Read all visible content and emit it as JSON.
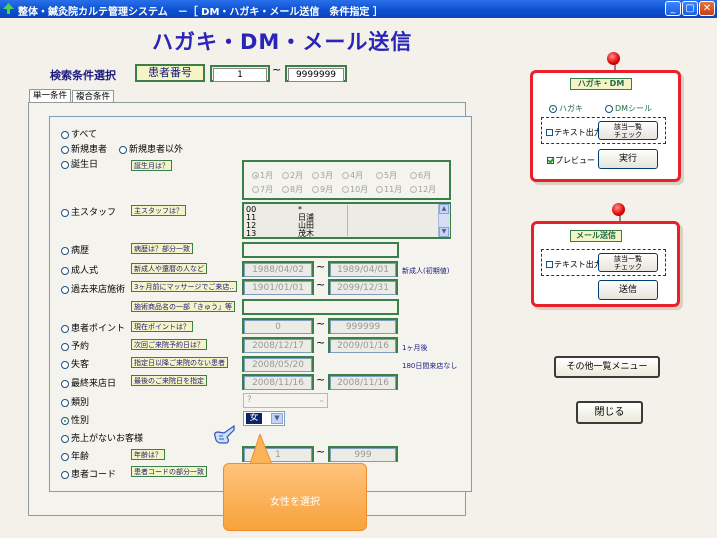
{
  "window": {
    "title": "整体・鍼灸院カルテ管理システム　－［ DM・ハガキ・メール送信　条件指定 ］",
    "colors": {
      "titlebar": "#0b4fd0",
      "accent_green": "#3a7f49",
      "headline": "#2a24b8",
      "card_border": "#e8202a"
    }
  },
  "header": {
    "headline": "ハガキ・DM・メール送信",
    "search_label": "検索条件選択",
    "patient_label": "患者番号",
    "range_from": "1",
    "range_sep": "~",
    "range_to": "9999999"
  },
  "tabs": [
    {
      "label": "単一条件",
      "active": true
    },
    {
      "label": "複合条件",
      "active": false
    }
  ],
  "conditions": {
    "all": "すべて",
    "new_patient": "新規患者",
    "not_new_patient": "新規患者以外",
    "birthday": "誕生日",
    "birthday_tag": "誕生月は？",
    "months_row1": [
      "1月",
      "2月",
      "3月",
      "4月",
      "5月",
      "6月"
    ],
    "months_row2": [
      "7月",
      "8月",
      "9月",
      "10月",
      "11月",
      "12月"
    ],
    "main_staff": "主スタッフ",
    "main_staff_tag": "主スタッフは？",
    "staff_list": [
      {
        "code": "00",
        "name": "*"
      },
      {
        "code": "11",
        "name": "日浦"
      },
      {
        "code": "12",
        "name": "山田"
      },
      {
        "code": "13",
        "name": "茂木"
      }
    ],
    "history": "病歴",
    "history_tag": "病歴は？部分一致",
    "coming_of_age": "成人式",
    "coming_of_age_tag": "新成人や還暦の人など",
    "coming_from": "1988/04/02",
    "coming_to": "1989/04/01",
    "coming_note": "新成人(初期値)",
    "past_treatment": "過去来店施術",
    "past_treatment_tag": "3ヶ月前にマッサージでご来店‥",
    "past_from": "1901/01/01",
    "past_to": "2099/12/31",
    "product_tag": "施術商品名の一部「きゅう」等",
    "points": "患者ポイント",
    "points_tag": "現在ポイントは？",
    "points_from": "0",
    "points_to": "999999",
    "reservation": "予約",
    "reservation_tag": "次回ご来院予約日は？",
    "res_from": "2008/12/17",
    "res_to": "2009/01/16",
    "res_note": "1ヶ月後",
    "lost": "失客",
    "lost_tag": "指定日以降ご来院のない患者",
    "lost_date": "2008/05/20",
    "lost_note": "180日間来店なし",
    "last_visit": "最終来店日",
    "last_visit_tag": "最後のご来院日を指定",
    "last_from": "2008/11/16",
    "last_to": "2008/11/16",
    "category": "類別",
    "category_value": "?",
    "gender": "性別",
    "gender_value": "女",
    "no_sales": "売上がないお客様",
    "age": "年齢",
    "age_tag": "年齢は？",
    "age_from": "1",
    "age_to": "999",
    "patient_code": "患者コード",
    "patient_code_tag": "患者コードの部分一致",
    "selected": "性別"
  },
  "callout": {
    "text": "女性を選択"
  },
  "dm_card": {
    "title": "ハガキ・DM",
    "opt_postcard": "ハガキ",
    "opt_seal": "DMシール",
    "selected": "ハガキ",
    "text_output": "テキスト出力",
    "applicable_list": "該当一覧\nチェック",
    "applicable_line1": "該当一覧",
    "applicable_line2": "チェック",
    "preview": "プレビュー",
    "preview_checked": true,
    "run": "実行"
  },
  "mail_card": {
    "title": "メール送信",
    "text_output": "テキスト出力",
    "applicable_line1": "該当一覧",
    "applicable_line2": "チェック",
    "send": "送信"
  },
  "other_list_menu": "その他一覧メニュー",
  "close_button": "閉じる",
  "icons": {
    "app": "app-tree-icon",
    "minimize": "minimize-icon",
    "maximize": "maximize-icon",
    "close": "close-icon",
    "pointer": "pointing-hand-icon",
    "pin": "push-pin-icon"
  }
}
